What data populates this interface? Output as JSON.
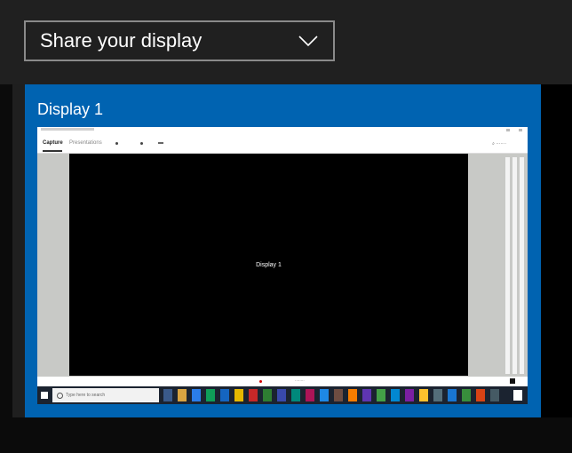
{
  "picker": {
    "label": "Share your display"
  },
  "displays": [
    {
      "name": "Display 1",
      "preview": {
        "tabs": [
          "Capture",
          "Presentations"
        ],
        "center_text": "Display 1",
        "taskbar_search": "Type here to search"
      }
    }
  ],
  "colors": {
    "tile_selected": "#0063b1",
    "chrome_background": "#202020",
    "dropdown_border": "#8a8a8a",
    "preview_taskbar": "#1b2330"
  },
  "icons": {
    "dropdown": "chevron-down-icon",
    "start": "windows-logo-icon",
    "search": "search-icon",
    "record": "record-dot-icon"
  }
}
